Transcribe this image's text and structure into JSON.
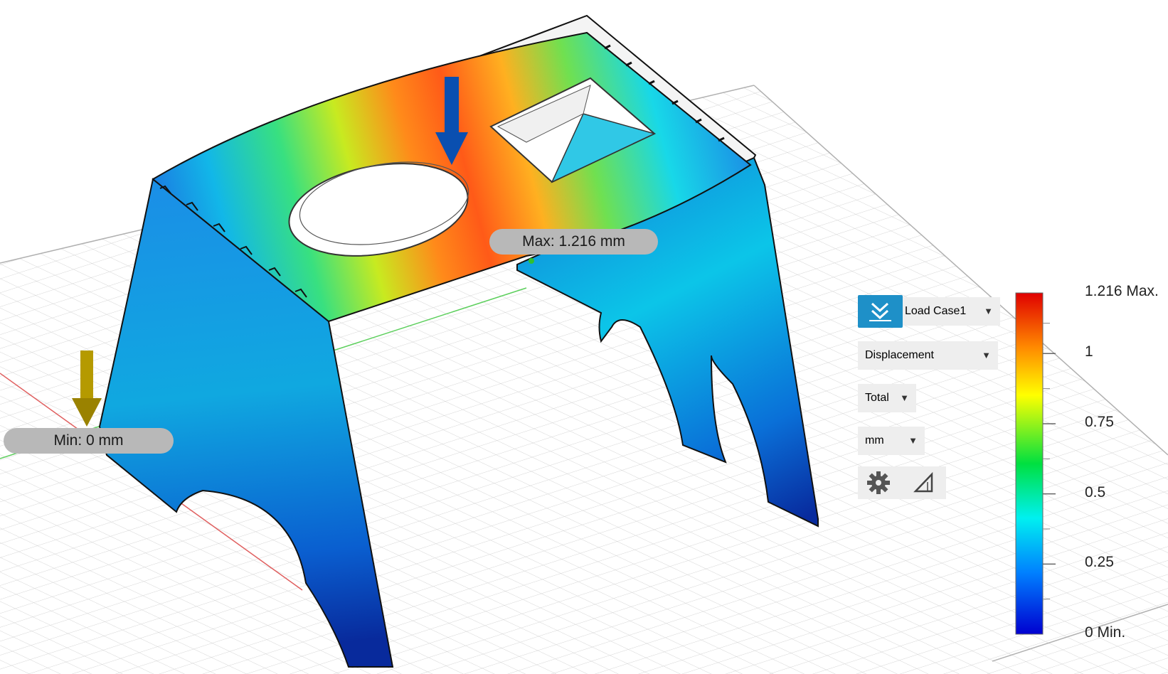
{
  "probe_labels": {
    "max": "Max: 1.216 mm",
    "min": "Min: 0 mm"
  },
  "results_panel": {
    "load_case": "Load Case1",
    "result_type": "Displacement",
    "component": "Total",
    "unit": "mm",
    "load_case_icon": "double-chevron-down-icon",
    "settings_icon": "gear-icon",
    "legend_options_icon": "triangle-ruler-icon"
  },
  "legend": {
    "max_label": "1.216 Max.",
    "min_label": "0 Min.",
    "ticks": [
      {
        "value": 1,
        "label": "1"
      },
      {
        "value": 0.75,
        "label": "0.75"
      },
      {
        "value": 0.5,
        "label": "0.5"
      },
      {
        "value": 0.25,
        "label": "0.25"
      }
    ],
    "max_value": 1.216,
    "min_value": 0
  },
  "colors": {
    "accent": "#1e90c8",
    "load_arrow": "#0a4fb0",
    "constraint_arrow": "#b59a00",
    "x_axis": "#e06060",
    "y_axis": "#5ccf5c"
  }
}
